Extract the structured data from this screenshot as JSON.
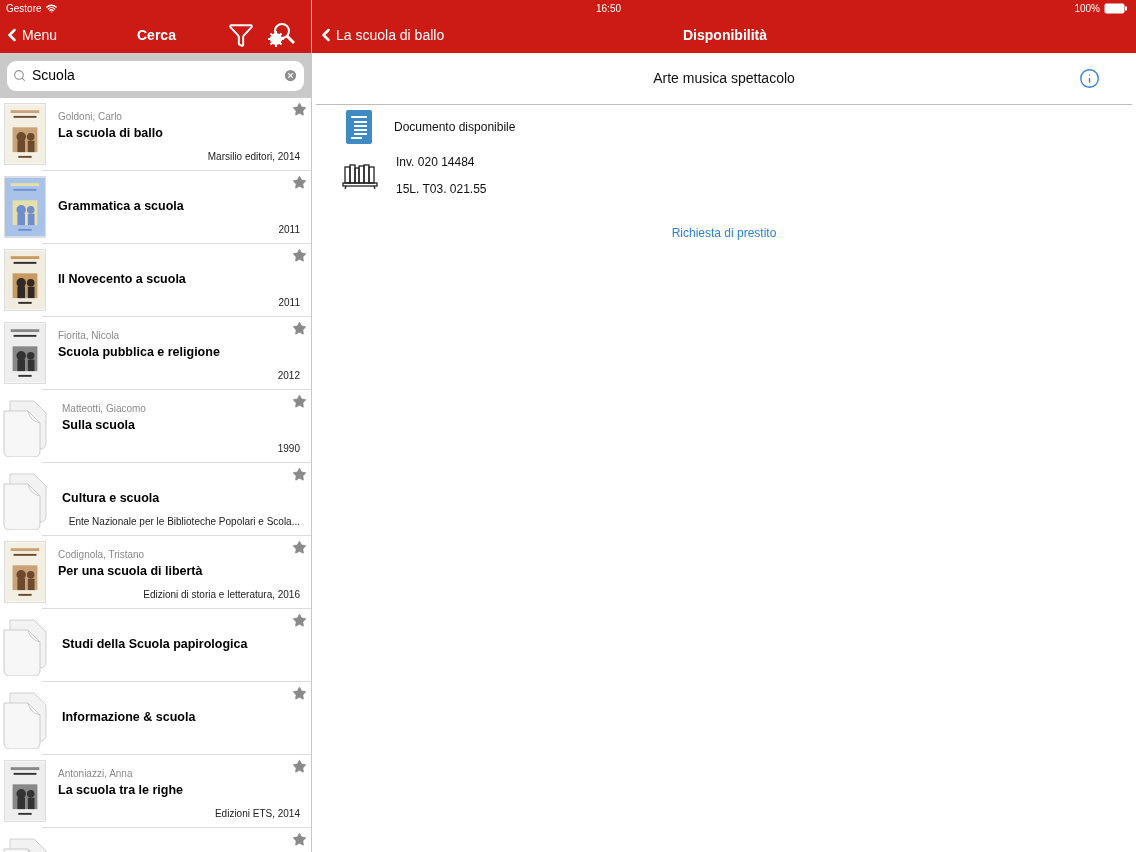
{
  "status_bar": {
    "carrier": "Gestore",
    "time": "16:50",
    "battery": "100%"
  },
  "left_nav": {
    "back": "Menu",
    "title": "Cerca"
  },
  "search": {
    "value": "Scuola"
  },
  "results": [
    {
      "kind": "picture",
      "author": "Goldoni, Carlo",
      "title": "La scuola di ballo",
      "publisher": "Marsilio editori, 2014"
    },
    {
      "kind": "picture",
      "title": "Grammatica a scuola",
      "publisher": "2011"
    },
    {
      "kind": "picture",
      "title": "Il Novecento a scuola",
      "publisher": "2011"
    },
    {
      "kind": "picture",
      "author": "Fiorita, Nicola",
      "title": "Scuola pubblica e religione",
      "publisher": "2012"
    },
    {
      "kind": "generic",
      "author": "Matteotti, Giacomo",
      "title": "Sulla scuola",
      "publisher": "1990"
    },
    {
      "kind": "generic",
      "title": "Cultura e scuola",
      "publisher": "Ente Nazionale per le Biblioteche Popolari e Scola..."
    },
    {
      "kind": "picture",
      "author": "Codignola, Tristano",
      "title": "Per una scuola di libertà",
      "publisher": "Edizioni di storia e letteratura, 2016"
    },
    {
      "kind": "generic",
      "title": "Studi della Scuola papirologica"
    },
    {
      "kind": "generic",
      "title": "Informazione & scuola"
    },
    {
      "kind": "picture",
      "author": "Antoniazzi, Anna",
      "title": "La scuola tra le righe",
      "publisher": "Edizioni ETS, 2014"
    },
    {
      "kind": "generic"
    }
  ],
  "right_nav": {
    "back": "La scuola di ballo",
    "title": "Disponibilità"
  },
  "section": {
    "title": "Arte musica spettacolo"
  },
  "availability": {
    "status": "Documento disponibile",
    "inventory": "Inv. 020 14484",
    "shelfmark": "15L. T03. 021.55"
  },
  "loan_link": "Richiesta di prestito"
}
